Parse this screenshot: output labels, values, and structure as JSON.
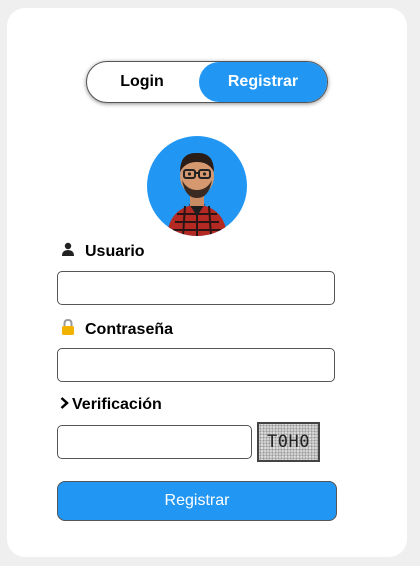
{
  "tabs": {
    "login": "Login",
    "register": "Registrar"
  },
  "form": {
    "user_label": "Usuario",
    "password_label": "Contraseña",
    "verification_label": "Verificación",
    "captcha_text": "T0H0",
    "user_value": "",
    "password_value": "",
    "verification_value": ""
  },
  "submit_label": "Registrar",
  "colors": {
    "accent": "#2196f3"
  },
  "icons": {
    "user": "user-icon",
    "lock": "lock-icon",
    "chevron": "chevron-right-icon"
  }
}
